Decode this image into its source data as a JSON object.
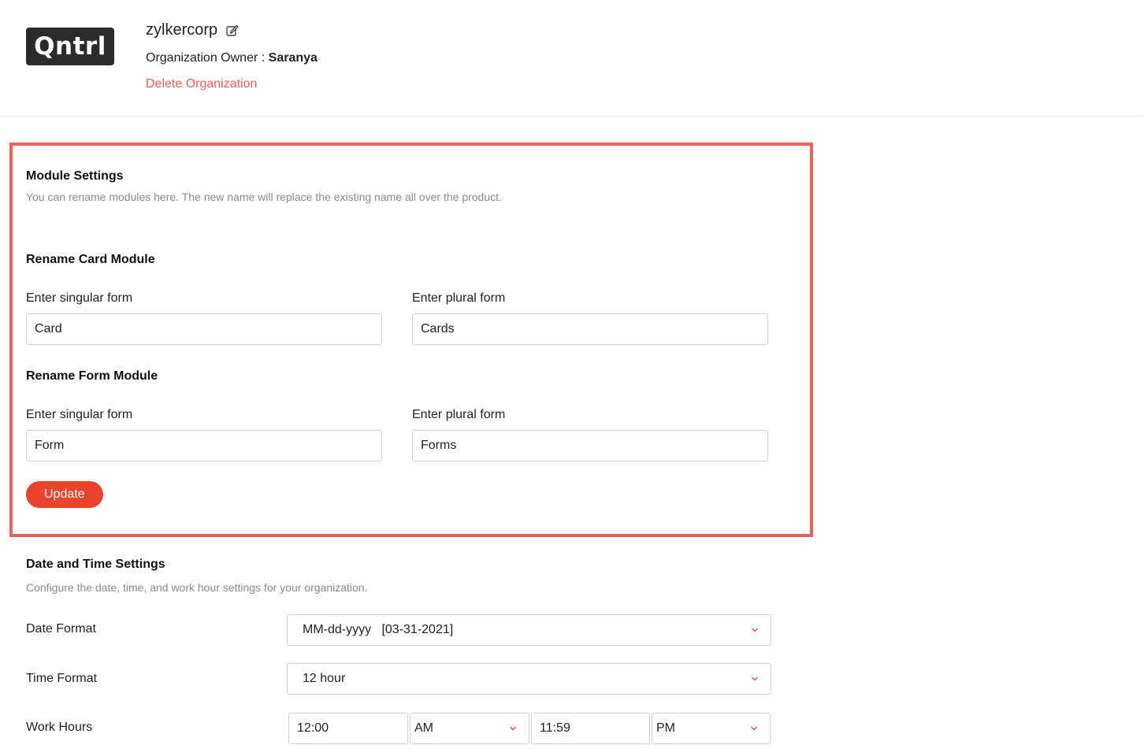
{
  "header": {
    "logo_text": "Qntrl",
    "org_name": "zylkercorp",
    "owner_label": "Organization Owner :",
    "owner_name": "Saranya",
    "delete_label": "Delete Organization"
  },
  "module_settings": {
    "title": "Module Settings",
    "description": "You can rename modules here. The new name will replace the existing name all over the product.",
    "card_module": {
      "title": "Rename Card Module",
      "singular_label": "Enter singular form",
      "singular_value": "Card",
      "plural_label": "Enter plural form",
      "plural_value": "Cards"
    },
    "form_module": {
      "title": "Rename Form Module",
      "singular_label": "Enter singular form",
      "singular_value": "Form",
      "plural_label": "Enter plural form",
      "plural_value": "Forms"
    },
    "update_label": "Update"
  },
  "date_time_settings": {
    "title": "Date and Time Settings",
    "description": "Configure the date, time, and work hour settings for your organization.",
    "date_format_label": "Date Format",
    "date_format_value": "MM-dd-yyyy   [03-31-2021]",
    "time_format_label": "Time Format",
    "time_format_value": "12 hour",
    "work_hours_label": "Work Hours",
    "work_start_time": "12:00",
    "work_start_meridiem": "AM",
    "work_end_time": "11:59",
    "work_end_meridiem": "PM"
  },
  "colors": {
    "accent": "#e8432c",
    "highlight_border": "#e8645a",
    "delete_link": "#e0605a"
  },
  "icons": {
    "edit": "edit-pencil-icon",
    "dropdown": "chevron-down-icon"
  }
}
